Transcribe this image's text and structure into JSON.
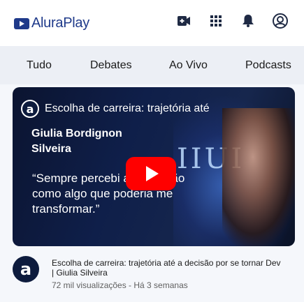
{
  "header": {
    "brand": "AluraPlay",
    "icons": [
      "upload-video-icon",
      "apps-grid-icon",
      "notifications-bell-icon",
      "account-avatar-icon"
    ]
  },
  "chips": [
    {
      "label": "Tudo"
    },
    {
      "label": "Debates"
    },
    {
      "label": "Ao Vivo"
    },
    {
      "label": "Podcasts"
    }
  ],
  "video": {
    "channel_initial": "a",
    "overlay_title": "Escolha de carreira: trajetória até",
    "speaker_line1": "Giulia Bordignon",
    "speaker_line2": "Silveira",
    "quote": "“Sempre percebi a educação como algo que poderia me transformar.”",
    "stage_text": "IIUI",
    "colors": {
      "play": "#ff0000",
      "brand": "#1f3a8a"
    }
  },
  "meta": {
    "avatar_initial": "a",
    "title": "Escolha de carreira: trajetória até a decisão por se tornar Dev | Giulia Silveira",
    "stats": "72 mil visualizações - Há 3 semanas"
  }
}
